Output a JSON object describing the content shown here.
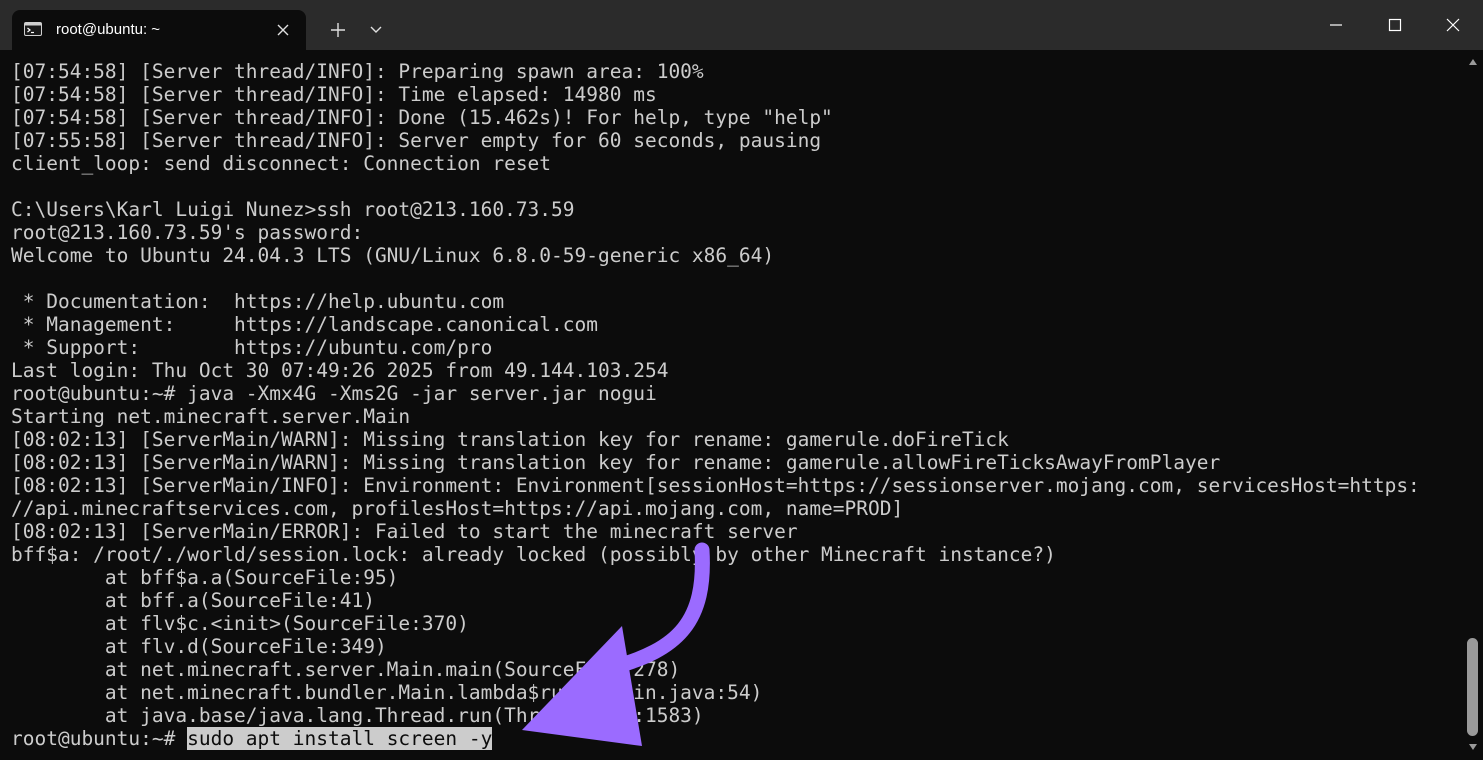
{
  "tab": {
    "title": "root@ubuntu: ~",
    "icon": "terminal-icon"
  },
  "titlebar_buttons": {
    "new_tab_icon": "plus-icon",
    "dropdown_icon": "chevron-down-icon",
    "minimize_icon": "minimize-icon",
    "maximize_icon": "maximize-icon",
    "close_icon": "close-icon"
  },
  "terminal": {
    "lines": [
      "[07:54:58] [Server thread/INFO]: Preparing spawn area: 100%",
      "[07:54:58] [Server thread/INFO]: Time elapsed: 14980 ms",
      "[07:54:58] [Server thread/INFO]: Done (15.462s)! For help, type \"help\"",
      "[07:55:58] [Server thread/INFO]: Server empty for 60 seconds, pausing",
      "client_loop: send disconnect: Connection reset",
      "",
      "C:\\Users\\Karl Luigi Nunez>ssh root@213.160.73.59",
      "root@213.160.73.59's password:",
      "Welcome to Ubuntu 24.04.3 LTS (GNU/Linux 6.8.0-59-generic x86_64)",
      "",
      " * Documentation:  https://help.ubuntu.com",
      " * Management:     https://landscape.canonical.com",
      " * Support:        https://ubuntu.com/pro",
      "Last login: Thu Oct 30 07:49:26 2025 from 49.144.103.254",
      "root@ubuntu:~# java -Xmx4G -Xms2G -jar server.jar nogui",
      "Starting net.minecraft.server.Main",
      "[08:02:13] [ServerMain/WARN]: Missing translation key for rename: gamerule.doFireTick",
      "[08:02:13] [ServerMain/WARN]: Missing translation key for rename: gamerule.allowFireTicksAwayFromPlayer",
      "[08:02:13] [ServerMain/INFO]: Environment: Environment[sessionHost=https://sessionserver.mojang.com, servicesHost=https:",
      "//api.minecraftservices.com, profilesHost=https://api.mojang.com, name=PROD]",
      "[08:02:13] [ServerMain/ERROR]: Failed to start the minecraft server",
      "bff$a: /root/./world/session.lock: already locked (possibly by other Minecraft instance?)",
      "        at bff$a.a(SourceFile:95)",
      "        at bff.a(SourceFile:41)",
      "        at flv$c.<init>(SourceFile:370)",
      "        at flv.d(SourceFile:349)",
      "        at net.minecraft.server.Main.main(SourceFile:278)",
      "        at net.minecraft.bundler.Main.lambda$run$0(Main.java:54)",
      "        at java.base/java.lang.Thread.run(Thread.java:1583)"
    ],
    "prompt": "root@ubuntu:~# ",
    "current_command": "sudo apt install screen -y"
  },
  "annotation": {
    "arrow_color": "#9b6bff"
  },
  "scrollbar": {
    "up_icon": "scroll-up-arrow-icon",
    "down_icon": "scroll-down-arrow-icon"
  }
}
